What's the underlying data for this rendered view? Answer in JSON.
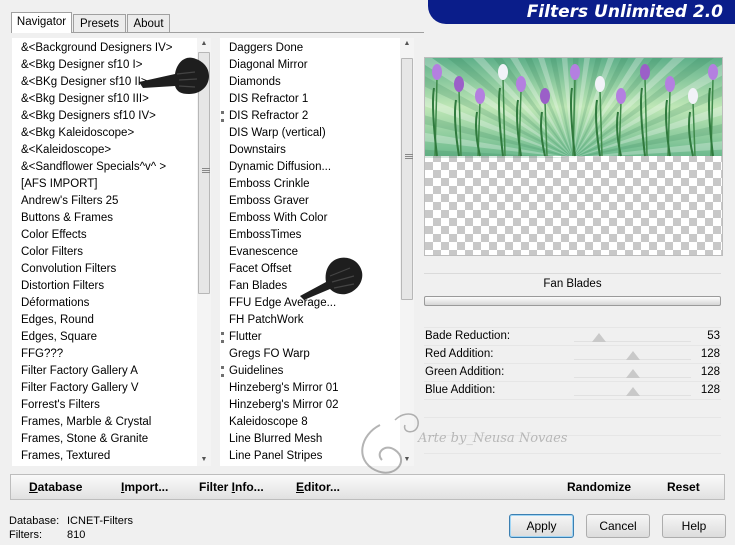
{
  "tabs": [
    {
      "label": "Navigator"
    },
    {
      "label": "Presets"
    },
    {
      "label": "About"
    }
  ],
  "banner": {
    "title": "Filters Unlimited 2.0"
  },
  "categories": [
    {
      "label": "&<Background Designers IV>"
    },
    {
      "label": "&<Bkg Designer sf10 I>"
    },
    {
      "label": "&<BKg Designer sf10 II>"
    },
    {
      "label": "&<Bkg Designer sf10 III>"
    },
    {
      "label": "&<Bkg Designers sf10 IV>"
    },
    {
      "label": "&<Bkg Kaleidoscope>"
    },
    {
      "label": "&<Kaleidoscope>"
    },
    {
      "label": "&<Sandflower Specials^v^ >"
    },
    {
      "label": "[AFS IMPORT]"
    },
    {
      "label": "Andrew's Filters 25"
    },
    {
      "label": "Buttons & Frames"
    },
    {
      "label": "Color Effects"
    },
    {
      "label": "Color Filters"
    },
    {
      "label": "Convolution Filters"
    },
    {
      "label": "Distortion Filters"
    },
    {
      "label": "Déformations"
    },
    {
      "label": "Edges, Round"
    },
    {
      "label": "Edges, Square"
    },
    {
      "label": "FFG???"
    },
    {
      "label": "Filter Factory Gallery A"
    },
    {
      "label": "Filter Factory Gallery V"
    },
    {
      "label": "Forrest's Filters"
    },
    {
      "label": "Frames, Marble & Crystal"
    },
    {
      "label": "Frames, Stone & Granite"
    },
    {
      "label": "Frames, Textured"
    }
  ],
  "filters": [
    {
      "label": "Daggers Done",
      "grouped": false
    },
    {
      "label": "Diagonal Mirror",
      "grouped": false
    },
    {
      "label": "Diamonds",
      "grouped": false
    },
    {
      "label": "DIS Refractor 1",
      "grouped": false
    },
    {
      "label": "DIS Refractor 2",
      "grouped": true
    },
    {
      "label": "DIS Warp (vertical)",
      "grouped": false
    },
    {
      "label": "Downstairs",
      "grouped": false
    },
    {
      "label": "Dynamic Diffusion...",
      "grouped": false
    },
    {
      "label": "Emboss Crinkle",
      "grouped": false
    },
    {
      "label": "Emboss Graver",
      "grouped": false
    },
    {
      "label": "Emboss With Color",
      "grouped": false
    },
    {
      "label": "EmbossTimes",
      "grouped": false
    },
    {
      "label": "Evanescence",
      "grouped": false
    },
    {
      "label": "Facet Offset",
      "grouped": false
    },
    {
      "label": "Fan Blades",
      "grouped": false
    },
    {
      "label": "FFU Edge Average...",
      "grouped": false
    },
    {
      "label": "FH PatchWork",
      "grouped": false
    },
    {
      "label": "Flutter",
      "grouped": true
    },
    {
      "label": "Gregs FO Warp",
      "grouped": false
    },
    {
      "label": "Guidelines",
      "grouped": true
    },
    {
      "label": "Hinzeberg's Mirror 01",
      "grouped": false
    },
    {
      "label": "Hinzeberg's Mirror 02",
      "grouped": false
    },
    {
      "label": "Kaleidoscope 8",
      "grouped": false
    },
    {
      "label": "Line Blurred Mesh",
      "grouped": false
    },
    {
      "label": "Line Panel Stripes",
      "grouped": false
    }
  ],
  "selected_filter": {
    "name": "Fan Blades"
  },
  "params": [
    {
      "label": "Bade Reduction:",
      "value": "53",
      "level": 0.21
    },
    {
      "label": "Red Addition:",
      "value": "128",
      "level": 0.5
    },
    {
      "label": "Green Addition:",
      "value": "128",
      "level": 0.5
    },
    {
      "label": "Blue Addition:",
      "value": "128",
      "level": 0.5
    }
  ],
  "toolbar": {
    "database": {
      "first": "D",
      "rest": "atabase"
    },
    "import": {
      "first": "I",
      "rest": "mport..."
    },
    "filter_info": {
      "pre": "Filter ",
      "mid": "I",
      "rest": "nfo..."
    },
    "editor": {
      "first": "E",
      "rest": "ditor..."
    },
    "randomize": "Randomize",
    "reset": "Reset"
  },
  "status": {
    "database_label": "Database:",
    "database_value": "ICNET-Filters",
    "filters_label": "Filters:",
    "filters_value": "810"
  },
  "buttons": {
    "apply": "Apply",
    "cancel": "Cancel",
    "help": "Help"
  },
  "watermark": {
    "text": "Arte by_Neusa Novaes"
  },
  "colors": {
    "banner": "#0a1d8a",
    "accent": "#3c7fb1"
  },
  "icons": [
    "pointing-hand-icon",
    "scroll-up-arrow-icon",
    "scroll-down-arrow-icon"
  ]
}
